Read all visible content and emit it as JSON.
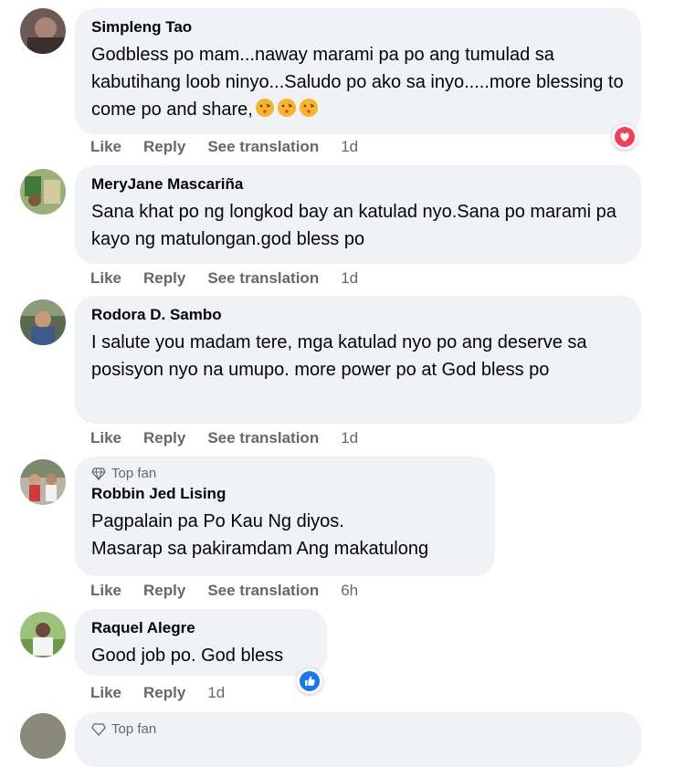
{
  "comments": [
    {
      "name": "Simpleng Tao",
      "text": "Godbless po mam...naway marami pa po ang tumulad sa kabutihang loob ninyo...Saludo po ako sa inyo.....more blessing to come po and share,",
      "emoji_count": 3,
      "actions": {
        "like": "Like",
        "reply": "Reply",
        "translate": "See translation",
        "time": "1d"
      },
      "reaction": "heart-icon"
    },
    {
      "name": "MeryJane Mascariña",
      "text": "Sana khat po ng longkod bay an katulad nyo.Sana po marami pa kayo ng matulongan.god bless po",
      "actions": {
        "like": "Like",
        "reply": "Reply",
        "translate": "See translation",
        "time": "1d"
      }
    },
    {
      "name": "Rodora D. Sambo",
      "text": "I salute you madam tere, mga katulad nyo po ang deserve sa posisyon nyo na umupo. more power po at God bless po",
      "actions": {
        "like": "Like",
        "reply": "Reply",
        "translate": "See translation",
        "time": "1d"
      }
    },
    {
      "badge": "Top fan",
      "name": "Robbin Jed Lising",
      "text": "Pagpalain pa Po Kau Ng diyos.\nMasarap sa pakiramdam Ang makatulong",
      "actions": {
        "like": "Like",
        "reply": "Reply",
        "translate": "See translation",
        "time": "6h"
      }
    },
    {
      "name": "Raquel Alegre",
      "text": "Good job po. God bless",
      "actions": {
        "like": "Like",
        "reply": "Reply",
        "time": "1d"
      },
      "reaction": "like-icon"
    }
  ],
  "partial_next": {
    "badge": "Top fan"
  },
  "colors": {
    "bubble": "#f0f2f5",
    "secondary_text": "#65676b",
    "heart": "#f33e58",
    "like": "#1877f2"
  }
}
